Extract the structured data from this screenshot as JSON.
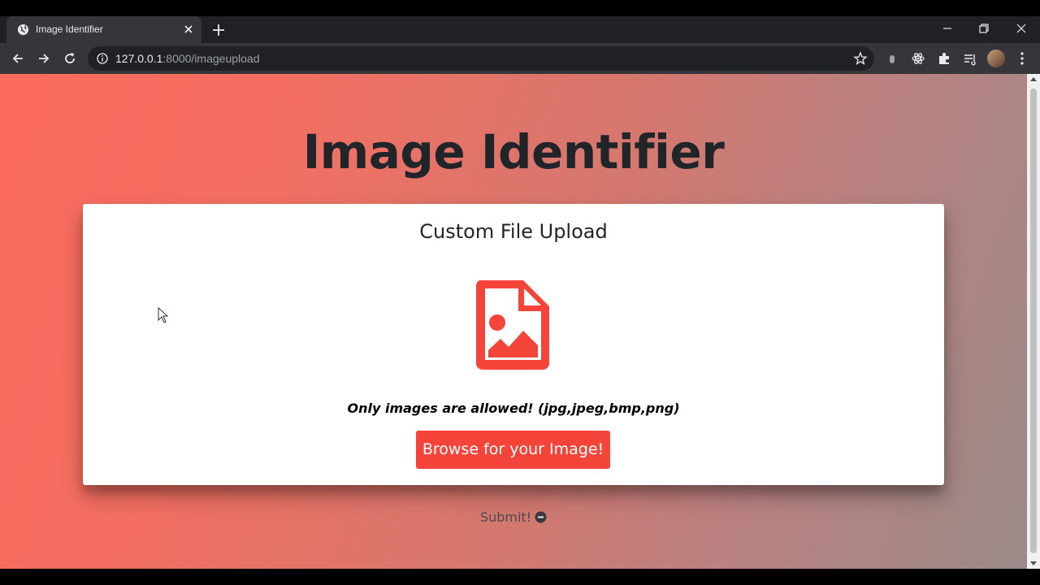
{
  "browser": {
    "tab_title": "Image Identifier",
    "url_host": "127.0.0.1",
    "url_rest": ":8000/imageupload"
  },
  "page": {
    "heading": "Image Identifier",
    "card_title": "Custom File Upload",
    "allowed_text": "Only images are allowed! (jpg,jpeg,bmp,png)",
    "browse_label": "Browse for your Image!",
    "submit_label": "Submit!"
  },
  "colors": {
    "accent": "#f5453a",
    "background_start": "#fb6a5e",
    "background_end": "#9a8a89"
  },
  "icons": [
    "globe-icon",
    "close-icon",
    "plus-icon",
    "minimize-icon",
    "restore-icon",
    "back-icon",
    "forward-icon",
    "reload-icon",
    "info-icon",
    "star-icon",
    "extensions-icon",
    "reading-list-icon",
    "menu-icon",
    "image-file-icon",
    "minus-circle-icon"
  ]
}
